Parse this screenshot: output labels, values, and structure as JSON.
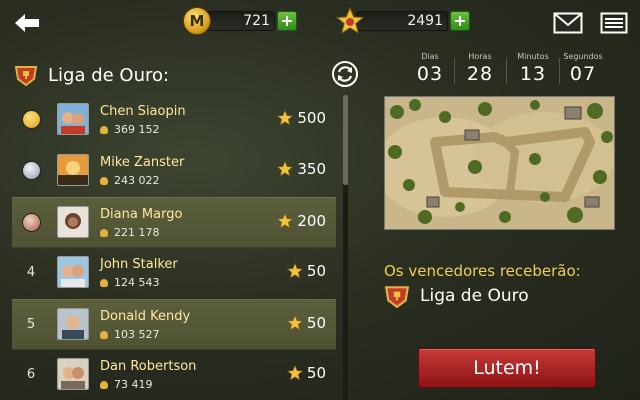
{
  "top_bar": {
    "back_icon": "arrow-left-icon",
    "currency": {
      "icon": "coin-icon",
      "value": "721",
      "plus_icon": "plus-icon"
    },
    "stars": {
      "icon": "star-icon",
      "value": "2491",
      "plus_icon": "plus-icon"
    },
    "mail_icon": "mail-icon",
    "menu_icon": "menu-icon"
  },
  "league": {
    "title": "Liga de Ouro:",
    "badge_icon": "league-badge-icon",
    "refresh_icon": "refresh-icon"
  },
  "timer": {
    "days_label": "Dias",
    "days": "03",
    "hours_label": "Horas",
    "hours": "28",
    "minutes_label": "Minutos",
    "minutes": "13",
    "seconds_label": "Segundos",
    "seconds": "07"
  },
  "leaderboard": [
    {
      "rank": "1",
      "medal": "gold",
      "name": "Chen Siaopin",
      "trophies": "369 152",
      "score": "500",
      "highlight": true
    },
    {
      "rank": "2",
      "medal": "silver",
      "name": "Mike Zanster",
      "trophies": "243 022",
      "score": "350",
      "highlight": false
    },
    {
      "rank": "3",
      "medal": "bronze",
      "name": "Diana Margo",
      "trophies": "221 178",
      "score": "200",
      "highlight": true
    },
    {
      "rank": "4",
      "medal": "",
      "name": "John Stalker",
      "trophies": "124 543",
      "score": "50",
      "highlight": false
    },
    {
      "rank": "5",
      "medal": "",
      "name": "Donald Kendy",
      "trophies": "103 527",
      "score": "50",
      "highlight": true
    },
    {
      "rank": "6",
      "medal": "",
      "name": "Dan Robertson",
      "trophies": "73 419",
      "score": "50",
      "highlight": false
    }
  ],
  "reward": {
    "winners_label": "Os vencedores receberão:",
    "prize_name": "Liga de Ouro"
  },
  "fight_button": "Lutem!",
  "colors": {
    "accent_gold": "#f0cf55",
    "plus_green": "#4aa62d",
    "fight_red": "#b02a28",
    "highlight_row": "#575a38"
  }
}
